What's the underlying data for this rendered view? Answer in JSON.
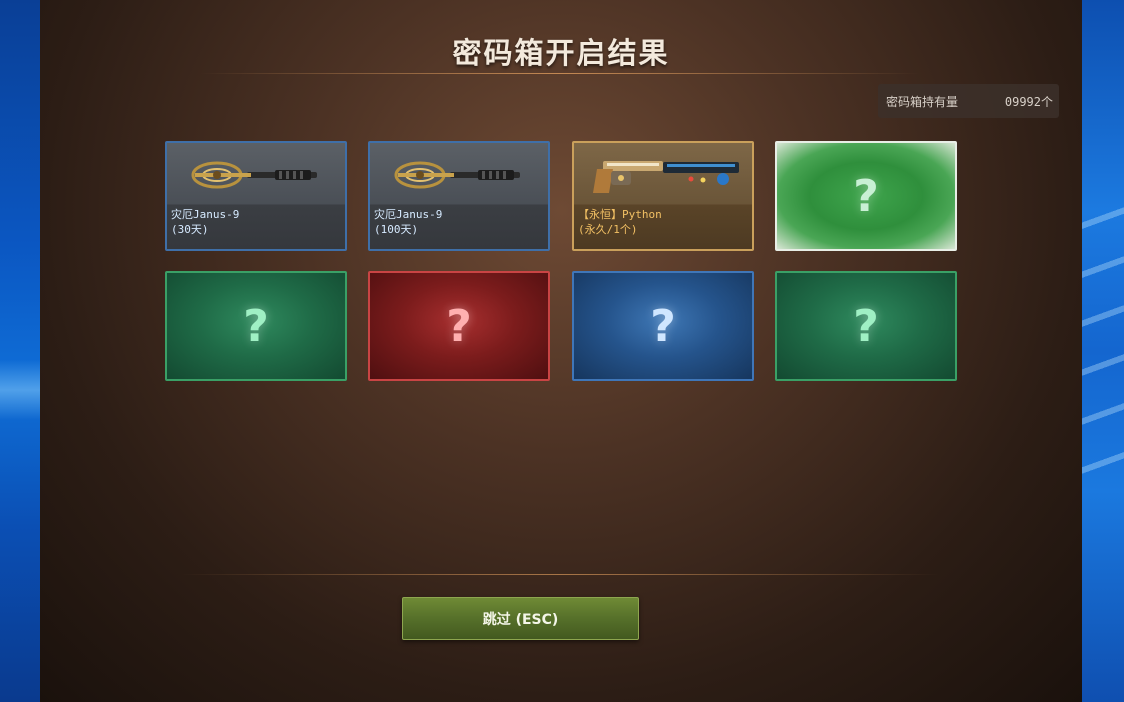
{
  "window": {
    "title": "密码箱开启结果"
  },
  "inventory": {
    "label": "密码箱持有量",
    "value": "09992个"
  },
  "rewards": [
    {
      "name": "灾厄Janus-9",
      "duration": "(30天)",
      "icon": "janus-9-weapon-icon"
    },
    {
      "name": "灾厄Janus-9",
      "duration": "(100天)",
      "icon": "janus-9-weapon-icon"
    },
    {
      "name": "【永恒】Python",
      "duration": "(永久/1个)",
      "icon": "python-revolver-icon"
    },
    {
      "symbol": "?",
      "style": "unrevealed-light-green"
    }
  ],
  "unrevealed": [
    {
      "symbol": "?",
      "style": "green"
    },
    {
      "symbol": "?",
      "style": "red"
    },
    {
      "symbol": "?",
      "style": "blue"
    },
    {
      "symbol": "?",
      "style": "green"
    }
  ],
  "skip_button": {
    "label": "跳过 (ESC)"
  },
  "colors": {
    "item_border": "#3f6fa8",
    "gold_border": "#caa05b",
    "skip_button": "#56702a"
  }
}
